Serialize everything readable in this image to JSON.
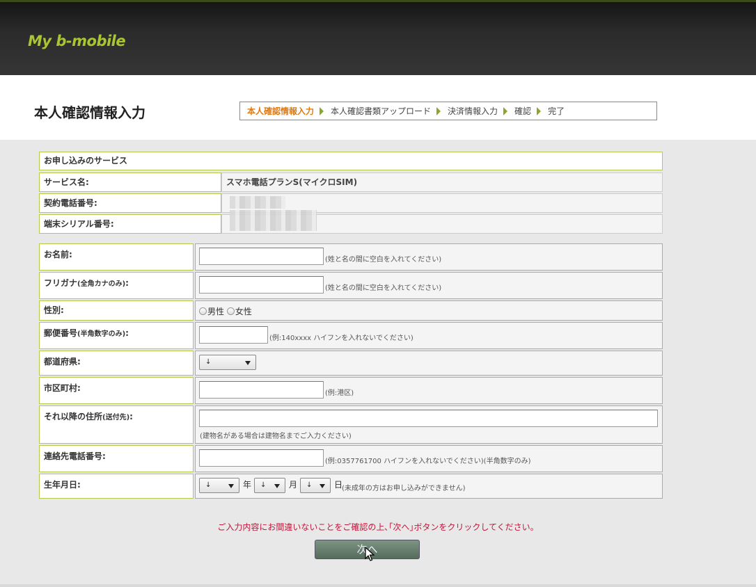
{
  "header": {
    "logo": "My b-mobile"
  },
  "page": {
    "title": "本人確認情報入力"
  },
  "steps": [
    {
      "label": "本人確認情報入力",
      "active": true
    },
    {
      "label": "本人確認書類アップロード",
      "active": false
    },
    {
      "label": "決済情報入力",
      "active": false
    },
    {
      "label": "確認",
      "active": false
    },
    {
      "label": "完了",
      "active": false
    }
  ],
  "service": {
    "section_title": "お申し込みのサービス",
    "name_label": "サービス名:",
    "name_value": "スマホ電話プランS(マイクロSIM)",
    "phone_label": "契約電話番号:",
    "serial_label": "端末シリアル番号:"
  },
  "form": {
    "name": {
      "label": "お名前:",
      "value": "",
      "note": "(姓と名の間に空白を入れてください)"
    },
    "kana": {
      "label": "フリガナ",
      "label_small": "(全角カナのみ)",
      "label_colon": ":",
      "value": "",
      "note": "(姓と名の間に空白を入れてください)"
    },
    "gender": {
      "label": "性別:",
      "options": [
        "男性",
        "女性"
      ]
    },
    "postal": {
      "label": "郵便番号",
      "label_small": "(半角数字のみ)",
      "label_colon": ":",
      "value": "",
      "note": "(例:140xxxx ハイフンを入れないでください)"
    },
    "prefecture": {
      "label": "都道府県:",
      "selected": "↓"
    },
    "city": {
      "label": "市区町村:",
      "value": "",
      "note": "(例:港区)"
    },
    "address": {
      "label": "それ以降の住所",
      "label_small": "(送付先)",
      "label_colon": ":",
      "value": "",
      "note": "(建物名がある場合は建物名までご入力ください)"
    },
    "contact_phone": {
      "label": "連絡先電話番号:",
      "value": "",
      "note": "(例:0357761700 ハイフンを入れないでください)(半角数字のみ)"
    },
    "birthdate": {
      "label": "生年月日:",
      "year_selected": "↓",
      "year_unit": "年",
      "month_selected": "↓",
      "month_unit": "月",
      "day_selected": "↓",
      "day_unit": "日",
      "note": "(未成年の方はお申し込みができません)"
    }
  },
  "notice": "ご入力内容にお間違いないことをご確認の上､｢次へ｣ボタンをクリックしてください。",
  "next_button": "次へ",
  "colors": {
    "accent": "#a9c530",
    "active_step": "#e07a10",
    "notice": "#c0163a",
    "border": "#b5c94a"
  }
}
